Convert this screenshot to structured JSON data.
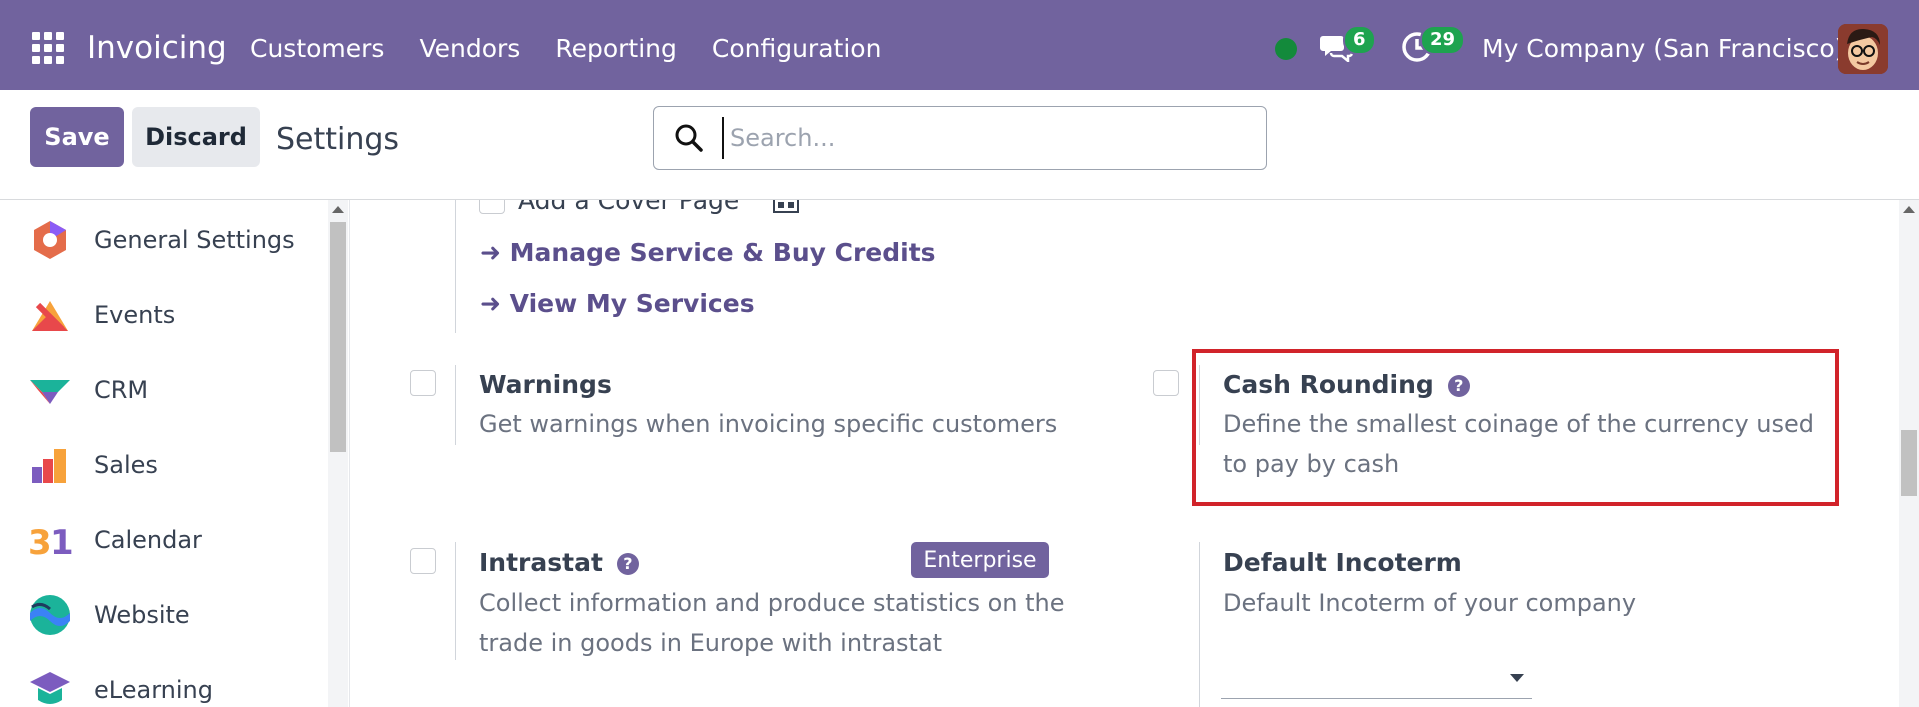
{
  "nav": {
    "app_name": "Invoicing",
    "menu": [
      "Customers",
      "Vendors",
      "Reporting",
      "Configuration"
    ],
    "messages_count": "6",
    "activities_count": "29",
    "company": "My Company (San Francisco)",
    "status_color": "#138a3b",
    "accent": "#71639e"
  },
  "control": {
    "save_label": "Save",
    "discard_label": "Discard",
    "title": "Settings",
    "search_placeholder": "Search..."
  },
  "sidebar": {
    "items": [
      {
        "label": "General Settings",
        "icon": "general-settings-icon"
      },
      {
        "label": "Events",
        "icon": "events-icon"
      },
      {
        "label": "CRM",
        "icon": "crm-icon"
      },
      {
        "label": "Sales",
        "icon": "sales-icon"
      },
      {
        "label": "Calendar",
        "icon": "calendar-icon"
      },
      {
        "label": "Website",
        "icon": "website-icon"
      },
      {
        "label": "eLearning",
        "icon": "elearning-icon"
      }
    ]
  },
  "main": {
    "cover_page_label": "Add a Cover Page",
    "links": {
      "manage_credits": "Manage Service & Buy Credits",
      "view_services": "View My Services"
    },
    "warnings": {
      "title": "Warnings",
      "desc": "Get warnings when invoicing specific customers"
    },
    "cash_rounding": {
      "title": "Cash Rounding",
      "desc": "Define the smallest coinage of the currency used to pay by cash"
    },
    "intrastat": {
      "title": "Intrastat",
      "badge": "Enterprise",
      "desc": "Collect information and produce statistics on the trade in goods in Europe with intrastat"
    },
    "incoterm": {
      "title": "Default Incoterm",
      "desc": "Default Incoterm of your company",
      "value": ""
    },
    "highlight_color": "#d1232a"
  }
}
